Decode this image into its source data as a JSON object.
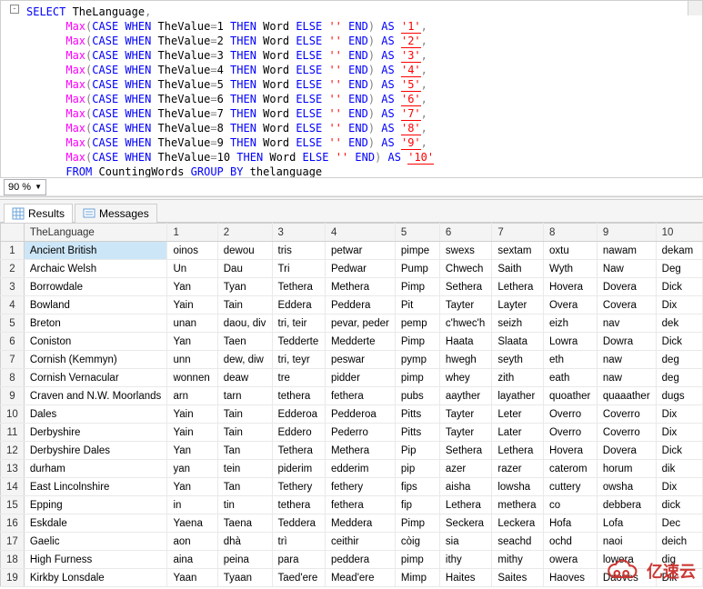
{
  "editor": {
    "indent": "      ",
    "sel": "SELECT",
    "lang_col": " TheLanguage",
    "comma": ",",
    "max": "Max",
    "lp": "(",
    "rp": ")",
    "case": "CASE",
    "when": "WHEN",
    "valcol": " TheValue",
    "eq": "=",
    "then": "THEN",
    "wordcol": " Word ",
    "else": "ELSE",
    "empty": "''",
    "end": "END",
    "as": "AS",
    "from": "FROM",
    "table": "CountingWords",
    "groupby": "GROUP BY",
    "grcol": " thelanguage",
    "nums": [
      "1",
      "2",
      "3",
      "4",
      "5",
      "6",
      "7",
      "8",
      "9",
      "10"
    ],
    "aliases": [
      "'1'",
      "'2'",
      "'3'",
      "'4'",
      "'5'",
      "'6'",
      "'7'",
      "'8'",
      "'9'",
      "'10'"
    ]
  },
  "zoom": {
    "value": "90 %"
  },
  "tabs": {
    "results": "Results",
    "messages": "Messages"
  },
  "grid": {
    "headers": [
      "",
      "TheLanguage",
      "1",
      "2",
      "3",
      "4",
      "5",
      "6",
      "7",
      "8",
      "9",
      "10"
    ],
    "rows": [
      [
        "1",
        "Ancient British",
        "oinos",
        "dewou",
        "tris",
        "petwar",
        "pimpe",
        "swexs",
        "sextam",
        "oxtu",
        "nawam",
        "dekam"
      ],
      [
        "2",
        "Archaic Welsh",
        "Un",
        "Dau",
        "Tri",
        "Pedwar",
        "Pump",
        "Chwech",
        "Saith",
        "Wyth",
        "Naw",
        "Deg"
      ],
      [
        "3",
        "Borrowdale",
        "Yan",
        "Tyan",
        "Tethera",
        "Methera",
        "Pimp",
        "Sethera",
        "Lethera",
        "Hovera",
        "Dovera",
        "Dick"
      ],
      [
        "4",
        "Bowland",
        "Yain",
        "Tain",
        "Eddera",
        "Peddera",
        "Pit",
        "Tayter",
        "Layter",
        "Overa",
        "Covera",
        "Dix"
      ],
      [
        "5",
        "Breton",
        "unan",
        "daou, div",
        "tri, teir",
        "pevar, peder",
        "pemp",
        "c'hwec'h",
        "seizh",
        "eizh",
        "nav",
        "dek"
      ],
      [
        "6",
        "Coniston",
        "Yan",
        "Taen",
        "Tedderte",
        "Medderte",
        "Pimp",
        "Haata",
        "Slaata",
        "Lowra",
        "Dowra",
        "Dick"
      ],
      [
        "7",
        "Cornish (Kemmyn)",
        "unn",
        "dew, diw",
        "tri, teyr",
        "peswar",
        "pymp",
        "hwegh",
        "seyth",
        "eth",
        "naw",
        "deg"
      ],
      [
        "8",
        "Cornish Vernacular",
        "wonnen",
        "deaw",
        "tre",
        "pidder",
        "pimp",
        "whey",
        "zith",
        "eath",
        "naw",
        "deg"
      ],
      [
        "9",
        "Craven and N.W. Moorlands",
        "arn",
        "tarn",
        "tethera",
        "fethera",
        "pubs",
        "aayther",
        "layather",
        "quoather",
        "quaaather",
        "dugs"
      ],
      [
        "10",
        "Dales",
        "Yain",
        "Tain",
        "Edderoa",
        "Pedderoa",
        "Pitts",
        "Tayter",
        "Leter",
        "Overro",
        "Coverro",
        "Dix"
      ],
      [
        "11",
        "Derbyshire",
        "Yain",
        "Tain",
        "Eddero",
        "Pederro",
        "Pitts",
        "Tayter",
        "Later",
        "Overro",
        "Coverro",
        "Dix"
      ],
      [
        "12",
        "Derbyshire Dales",
        "Yan",
        "Tan",
        "Tethera",
        "Methera",
        "Pip",
        "Sethera",
        "Lethera",
        "Hovera",
        "Dovera",
        "Dick"
      ],
      [
        "13",
        "durham",
        "yan",
        "tein",
        "piderim",
        "edderim",
        "pip",
        "azer",
        "razer",
        "caterom",
        "horum",
        "dik"
      ],
      [
        "14",
        "East Lincolnshire",
        "Yan",
        "Tan",
        "Tethery",
        "fethery",
        "fips",
        "aisha",
        "lowsha",
        "cuttery",
        "owsha",
        "Dix"
      ],
      [
        "15",
        "Epping",
        "in",
        "tin",
        "tethera",
        "fethera",
        "fip",
        "Lethera",
        "methera",
        "co",
        "debbera",
        "dick"
      ],
      [
        "16",
        "Eskdale",
        "Yaena",
        "Taena",
        "Teddera",
        "Meddera",
        "Pimp",
        "Seckera",
        "Leckera",
        "Hofa",
        "Lofa",
        "Dec"
      ],
      [
        "17",
        "Gaelic",
        "aon",
        "dhà",
        "trì",
        "ceithir",
        "còig",
        "sia",
        "seachd",
        "ochd",
        "naoi",
        "deich"
      ],
      [
        "18",
        "High Furness",
        "aina",
        "peina",
        "para",
        "peddera",
        "pimp",
        "ithy",
        "mithy",
        "owera",
        "lowera",
        "dig"
      ],
      [
        "19",
        "Kirkby Lonsdale",
        "Yaan",
        "Tyaan",
        "Taed'ere",
        "Mead'ere",
        "Mimp",
        "Haites",
        "Saites",
        "Haoves",
        "Daoves",
        "Dik"
      ]
    ]
  },
  "watermark": {
    "text": "亿速云"
  }
}
